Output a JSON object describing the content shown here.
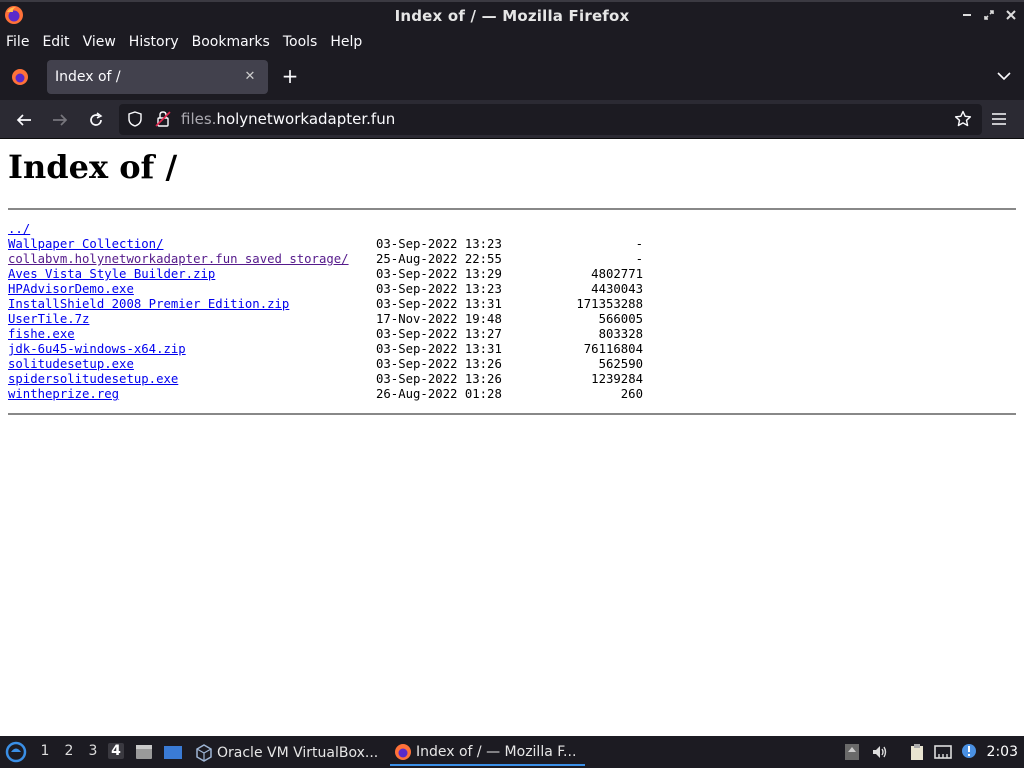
{
  "window": {
    "title": "Index of / — Mozilla Firefox"
  },
  "menu": {
    "items": [
      "File",
      "Edit",
      "View",
      "History",
      "Bookmarks",
      "Tools",
      "Help"
    ]
  },
  "tab": {
    "title": "Index of /",
    "close_glyph": "✕",
    "new_tab_glyph": "+"
  },
  "nav": {
    "url_host_dim": "files.",
    "url_host": "holynetworkadapter.fun"
  },
  "page": {
    "heading": "Index of /",
    "parent_link": "../",
    "entries": [
      {
        "name": "Wallpaper Collection/",
        "date": "03-Sep-2022 13:23",
        "size": "-",
        "visited": false
      },
      {
        "name": "collabvm.holynetworkadapter.fun saved storage/",
        "date": "25-Aug-2022 22:55",
        "size": "-",
        "visited": true
      },
      {
        "name": "Aves Vista Style Builder.zip",
        "date": "03-Sep-2022 13:29",
        "size": "4802771",
        "visited": false
      },
      {
        "name": "HPAdvisorDemo.exe",
        "date": "03-Sep-2022 13:23",
        "size": "4430043",
        "visited": false
      },
      {
        "name": "InstallShield 2008 Premier Edition.zip",
        "date": "03-Sep-2022 13:31",
        "size": "171353288",
        "visited": false
      },
      {
        "name": "UserTile.7z",
        "date": "17-Nov-2022 19:48",
        "size": "566005",
        "visited": false
      },
      {
        "name": "fishe.exe",
        "date": "03-Sep-2022 13:27",
        "size": "803328",
        "visited": false
      },
      {
        "name": "jdk-6u45-windows-x64.zip",
        "date": "03-Sep-2022 13:31",
        "size": "76116804",
        "visited": false
      },
      {
        "name": "solitudesetup.exe",
        "date": "03-Sep-2022 13:26",
        "size": "562590",
        "visited": false
      },
      {
        "name": "spidersolitudesetup.exe",
        "date": "03-Sep-2022 13:26",
        "size": "1239284",
        "visited": false
      },
      {
        "name": "wintheprize.reg",
        "date": "26-Aug-2022 01:28",
        "size": "260",
        "visited": false
      }
    ]
  },
  "taskbar": {
    "workspaces": [
      "1",
      "2",
      "3",
      "4"
    ],
    "active_workspace": "4",
    "tasks": [
      {
        "label": "Oracle VM VirtualBox...",
        "icon": "virtualbox-icon"
      },
      {
        "label": "Index of / — Mozilla F...",
        "icon": "firefox-icon"
      }
    ],
    "clock": "2:03"
  },
  "colors": {
    "chrome_dark": "#1c1b22",
    "toolbar": "#2b2a33",
    "tab_selected": "#42414d",
    "link": "#0000ee",
    "link_visited": "#551a8b",
    "task_active_accent": "#3a8fe6"
  }
}
